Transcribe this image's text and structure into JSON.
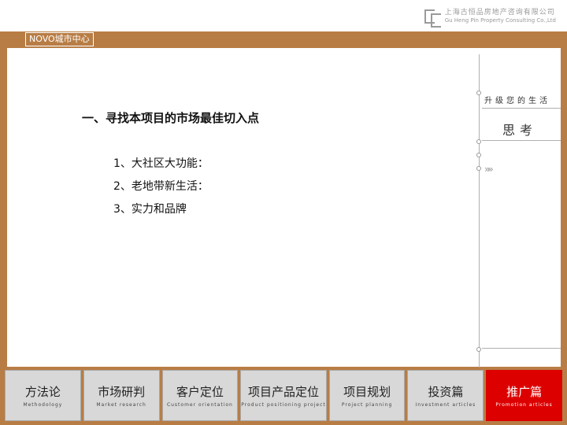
{
  "header": {
    "logo_cn": "上海古恒品房地产咨询有限公司",
    "logo_en": "Gu Heng Pin Property Consulting Co.,Ltd"
  },
  "brand": "NOVO城市中心",
  "main": {
    "headline": "一、寻找本项目的市场最佳切入点",
    "items": [
      "1、大社区大功能：",
      "2、老地带新生活：",
      "3、实力和品牌"
    ]
  },
  "sidebar": {
    "slogan": "升级您的生活",
    "section": "思考",
    "arrow_glyph": "»»"
  },
  "nav": {
    "tabs": [
      {
        "cn": "方法论",
        "en": "Methodology"
      },
      {
        "cn": "市场研判",
        "en": "Market research"
      },
      {
        "cn": "客户定位",
        "en": "Customer orientation"
      },
      {
        "cn": "项目产品定位",
        "en": "Product positioning project"
      },
      {
        "cn": "项目规划",
        "en": "Project planning"
      },
      {
        "cn": "投资篇",
        "en": "Investment articles"
      },
      {
        "cn": "推广篇",
        "en": "Promotion articles"
      }
    ],
    "active_index": 6
  },
  "colors": {
    "frame": "#b87d45",
    "active_tab": "#dd0000",
    "tab_bg": "#d8d8d8"
  }
}
